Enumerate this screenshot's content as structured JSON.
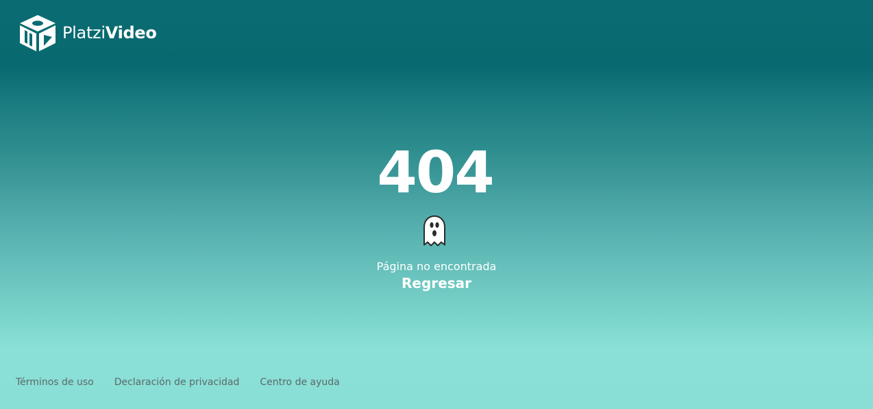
{
  "brand": {
    "name_light": "Platzi",
    "name_bold": "Video",
    "logo_icon": "platzi-video-cube-logo"
  },
  "error": {
    "code": "404",
    "icon": "ghost-icon",
    "message": "Página no encontrada",
    "back_label": "Regresar"
  },
  "footer": {
    "links": [
      {
        "label": "Términos de uso"
      },
      {
        "label": "Declaración de privacidad"
      },
      {
        "label": "Centro de ayuda"
      }
    ]
  },
  "colors": {
    "gradient_top": "#086a70",
    "gradient_bottom": "#89ded5",
    "text": "#ffffff",
    "footer_text": "#5c6a6a"
  }
}
